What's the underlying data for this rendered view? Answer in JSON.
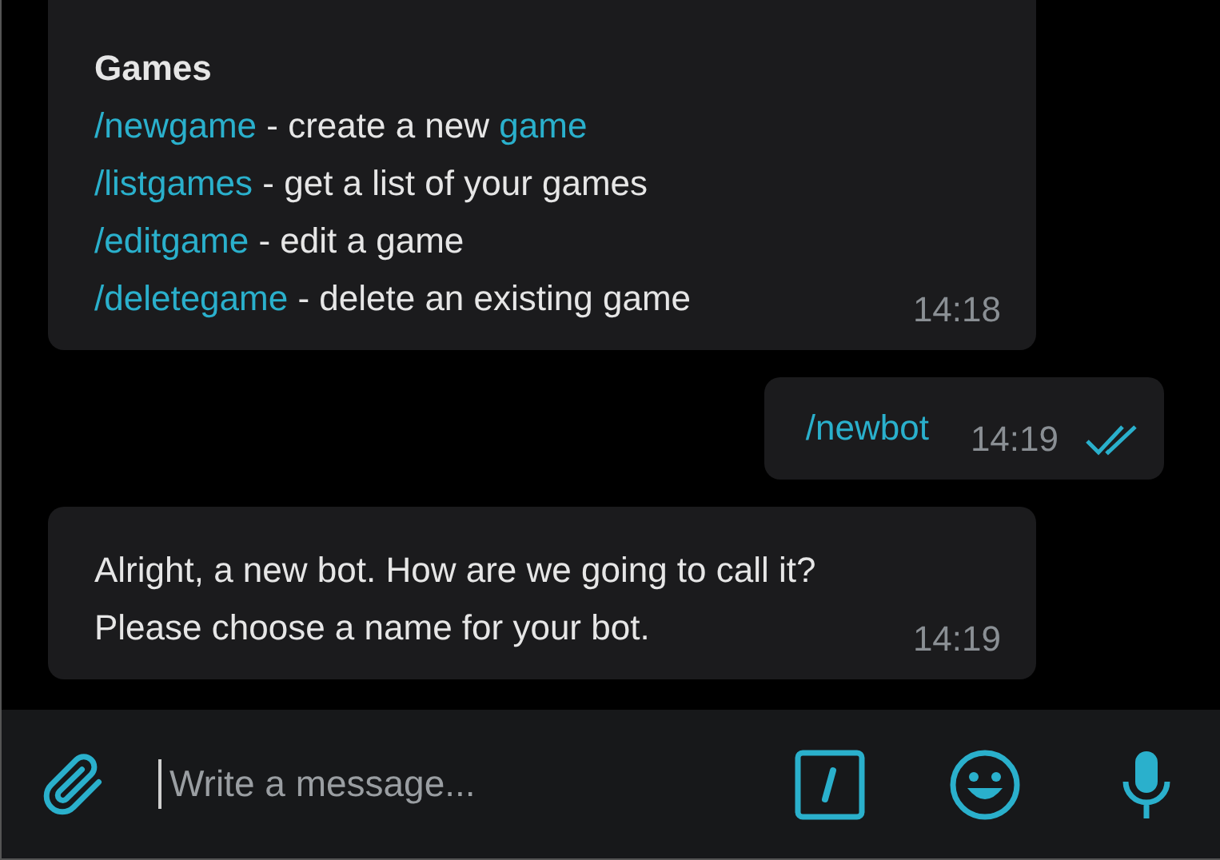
{
  "messages": [
    {
      "kind": "incoming",
      "time": "14:18",
      "lines": [
        {
          "kind": "heading",
          "segments": [
            {
              "kind": "text",
              "text": "Games"
            }
          ]
        },
        {
          "kind": "entry",
          "segments": [
            {
              "kind": "command",
              "text": "/newgame"
            },
            {
              "kind": "text",
              "text": " - create a new "
            },
            {
              "kind": "command",
              "text": "game"
            }
          ]
        },
        {
          "kind": "entry",
          "segments": [
            {
              "kind": "command",
              "text": "/listgames"
            },
            {
              "kind": "text",
              "text": " - get a list of your games"
            }
          ]
        },
        {
          "kind": "entry",
          "segments": [
            {
              "kind": "command",
              "text": "/editgame"
            },
            {
              "kind": "text",
              "text": " - edit a game"
            }
          ]
        },
        {
          "kind": "entry",
          "segments": [
            {
              "kind": "command",
              "text": "/deletegame"
            },
            {
              "kind": "text",
              "text": " - delete an existing game"
            }
          ]
        }
      ]
    },
    {
      "kind": "outgoing",
      "time": "14:19",
      "read": true,
      "lines": [
        {
          "kind": "entry",
          "segments": [
            {
              "kind": "command",
              "text": "/newbot"
            }
          ]
        }
      ]
    },
    {
      "kind": "incoming",
      "time": "14:19",
      "lines": [
        {
          "kind": "entry",
          "segments": [
            {
              "kind": "text",
              "text": "Alright, a new bot. How are we going to call it?"
            }
          ]
        },
        {
          "kind": "entry",
          "segments": [
            {
              "kind": "text",
              "text": "Please choose a name for your bot."
            }
          ]
        }
      ]
    }
  ],
  "composer": {
    "placeholder": "Write a message..."
  }
}
